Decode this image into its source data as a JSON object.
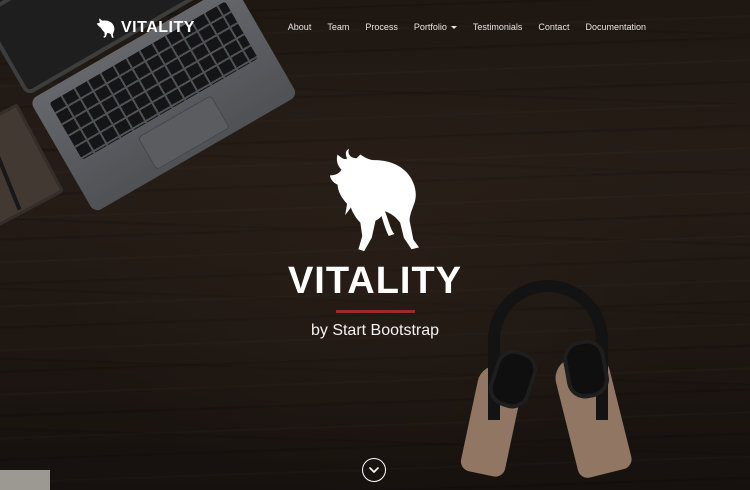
{
  "brand": {
    "name": "VITALITY",
    "icon": "bull-icon"
  },
  "nav": {
    "items": [
      {
        "label": "About"
      },
      {
        "label": "Team"
      },
      {
        "label": "Process"
      },
      {
        "label": "Portfolio",
        "dropdown": true
      },
      {
        "label": "Testimonials"
      },
      {
        "label": "Contact"
      },
      {
        "label": "Documentation"
      }
    ]
  },
  "hero": {
    "icon": "bull-icon",
    "title": "VITALITY",
    "subtitle": "by Start Bootstrap",
    "scroll_icon": "chevron-down-icon"
  },
  "colors": {
    "accent": "#9a2b27",
    "text": "#ffffff"
  }
}
